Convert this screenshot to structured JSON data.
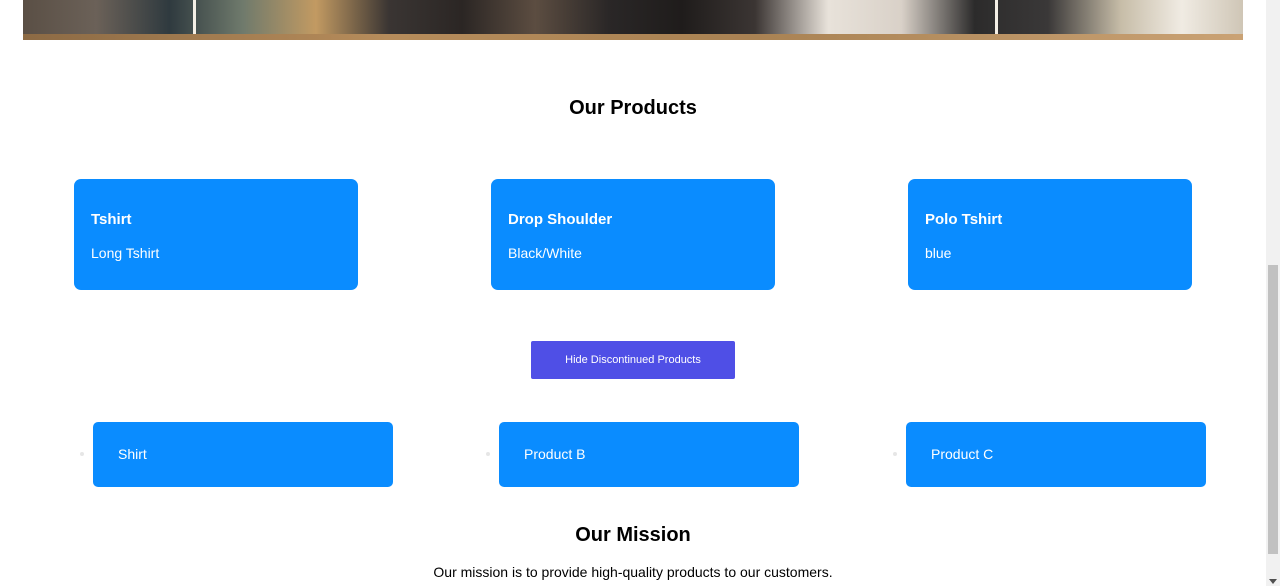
{
  "products_section": {
    "title": "Our Products",
    "cards": [
      {
        "name": "Tshirt",
        "description": "Long Tshirt"
      },
      {
        "name": "Drop Shoulder",
        "description": "Black/White"
      },
      {
        "name": "Polo Tshirt",
        "description": "blue"
      }
    ],
    "hide_button_label": "Hide Discontinued Products",
    "list_items": [
      "Shirt",
      "Product B",
      "Product C"
    ]
  },
  "mission_section": {
    "title": "Our Mission",
    "text": "Our mission is to provide high-quality products to our customers."
  },
  "colors": {
    "card_blue": "#0a8cff",
    "button_indigo": "#4f4fe6"
  }
}
